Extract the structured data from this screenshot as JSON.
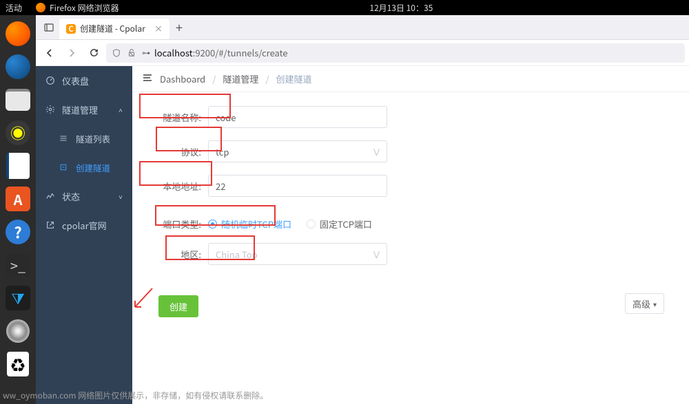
{
  "gnome": {
    "activities": "活动",
    "app_name": "Firefox 网络浏览器",
    "datetime": "12月13日 10：35"
  },
  "browser": {
    "tab_title": "创建隧道 - Cpolar",
    "tab_favicon_letter": "C",
    "url_prefix": "localhost",
    "url_rest": ":9200/#/tunnels/create"
  },
  "sidebar": {
    "items": [
      {
        "label": "仪表盘",
        "icon": "dashboard"
      },
      {
        "label": "隧道管理",
        "icon": "settings",
        "expanded": true
      },
      {
        "label": "隧道列表",
        "icon": "list",
        "sub": true
      },
      {
        "label": "创建隧道",
        "icon": "create",
        "sub": true,
        "active": true
      },
      {
        "label": "状态",
        "icon": "status",
        "expanded": false
      },
      {
        "label": "cpolar官网",
        "icon": "external"
      }
    ]
  },
  "breadcrumb": {
    "items": [
      "Dashboard",
      "隧道管理",
      "创建隧道"
    ]
  },
  "form": {
    "fields": {
      "name_label": "隧道名称:",
      "name_value": "code",
      "proto_label": "协议:",
      "proto_value": "tcp",
      "addr_label": "本地地址:",
      "addr_value": "22",
      "port_type_label": "端口类型:",
      "port_type_opt1": "随机临时TCP端口",
      "port_type_opt2": "固定TCP端口",
      "region_label": "地区:",
      "region_value": "China Top"
    },
    "advanced": "高级",
    "submit": "创建"
  },
  "footer": "ww_oymoban.com 网络图片仅供展示，非存储，如有侵权请联系删除。"
}
